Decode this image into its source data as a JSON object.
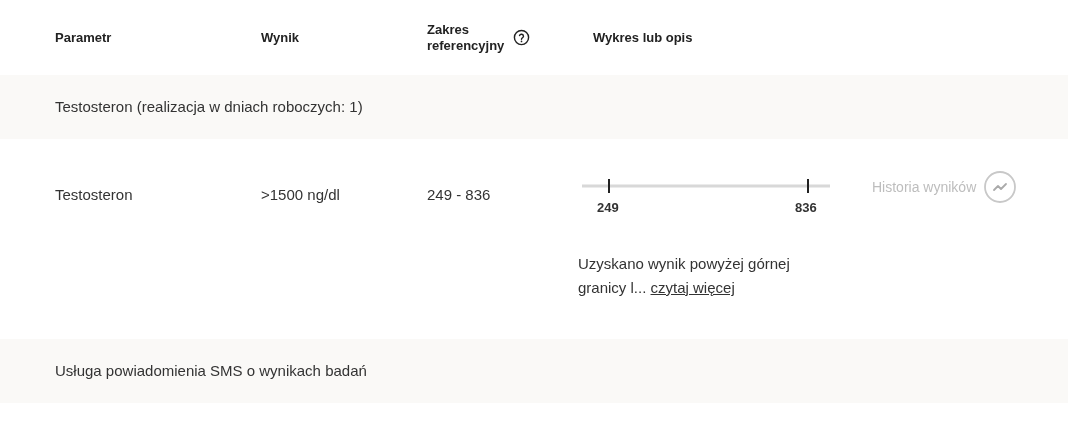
{
  "columns": [
    {
      "label": "Parametr"
    },
    {
      "label": "Wynik"
    },
    {
      "label": "Zakres referencyjny",
      "help": true
    },
    {
      "label": "Wykres lub opis"
    }
  ],
  "groups": [
    {
      "title": "Testosteron (realizacja w dniach roboczych: 1)",
      "rows": [
        {
          "parameter": "Testosteron",
          "result": ">1500 ng/dl",
          "range": "249 - 836",
          "scale": {
            "low": "249",
            "high": "836"
          },
          "description": "Uzyskano wynik powyżej górnej granicy l...",
          "more_link": "czytaj więcej",
          "history": {
            "label": "Historia wyników",
            "disabled": true
          }
        }
      ]
    },
    {
      "title": "Usługa powiadomienia SMS o wynikach badań"
    }
  ]
}
